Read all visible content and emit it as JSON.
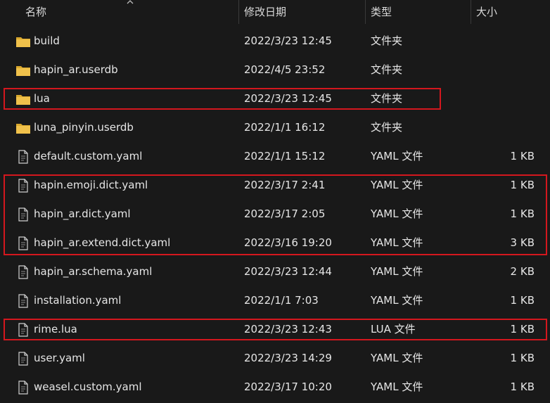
{
  "columns": {
    "name": "名称",
    "date": "修改日期",
    "type": "类型",
    "size": "大小"
  },
  "files": [
    {
      "name": "build",
      "date": "2022/3/23 12:45",
      "type": "文件夹",
      "size": "",
      "icon": "folder-icon"
    },
    {
      "name": "hapin_ar.userdb",
      "date": "2022/4/5 23:52",
      "type": "文件夹",
      "size": "",
      "icon": "folder-icon"
    },
    {
      "name": "lua",
      "date": "2022/3/23 12:45",
      "type": "文件夹",
      "size": "",
      "icon": "folder-icon"
    },
    {
      "name": "luna_pinyin.userdb",
      "date": "2022/1/1 16:12",
      "type": "文件夹",
      "size": "",
      "icon": "folder-icon"
    },
    {
      "name": "default.custom.yaml",
      "date": "2022/1/1 15:12",
      "type": "YAML 文件",
      "size": "1 KB",
      "icon": "file-icon"
    },
    {
      "name": "hapin.emoji.dict.yaml",
      "date": "2022/3/17 2:41",
      "type": "YAML 文件",
      "size": "1 KB",
      "icon": "file-icon"
    },
    {
      "name": "hapin_ar.dict.yaml",
      "date": "2022/3/17 2:05",
      "type": "YAML 文件",
      "size": "1 KB",
      "icon": "file-icon"
    },
    {
      "name": "hapin_ar.extend.dict.yaml",
      "date": "2022/3/16 19:20",
      "type": "YAML 文件",
      "size": "3 KB",
      "icon": "file-icon"
    },
    {
      "name": "hapin_ar.schema.yaml",
      "date": "2022/3/23 12:44",
      "type": "YAML 文件",
      "size": "2 KB",
      "icon": "file-icon"
    },
    {
      "name": "installation.yaml",
      "date": "2022/1/1 7:03",
      "type": "YAML 文件",
      "size": "1 KB",
      "icon": "file-icon"
    },
    {
      "name": "rime.lua",
      "date": "2022/3/23 12:43",
      "type": "LUA 文件",
      "size": "1 KB",
      "icon": "file-icon"
    },
    {
      "name": "user.yaml",
      "date": "2022/3/23 14:29",
      "type": "YAML 文件",
      "size": "1 KB",
      "icon": "file-icon"
    },
    {
      "name": "weasel.custom.yaml",
      "date": "2022/3/17 10:20",
      "type": "YAML 文件",
      "size": "1 KB",
      "icon": "file-icon"
    }
  ],
  "highlight_color": "#d4171e",
  "folder_color": "#f0c14b"
}
